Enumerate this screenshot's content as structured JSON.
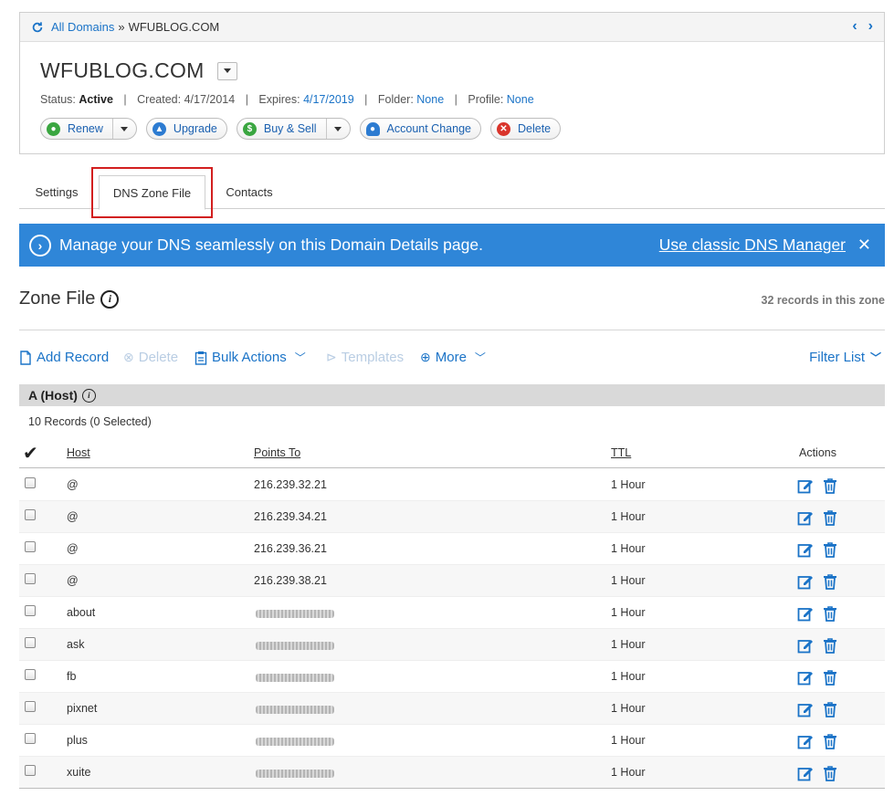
{
  "breadcrumb": {
    "root": "All Domains",
    "separator": "»",
    "current": "WFUBLOG.COM"
  },
  "domain": {
    "name": "WFUBLOG.COM",
    "status_label": "Status:",
    "status_value": "Active",
    "created_label": "Created:",
    "created_value": "4/17/2014",
    "expires_label": "Expires:",
    "expires_value": "4/17/2019",
    "folder_label": "Folder:",
    "folder_value": "None",
    "profile_label": "Profile:",
    "profile_value": "None"
  },
  "actions": {
    "renew": "Renew",
    "upgrade": "Upgrade",
    "buy_sell": "Buy & Sell",
    "account_change": "Account Change",
    "delete": "Delete"
  },
  "tabs": {
    "settings": "Settings",
    "dns_zone_file": "DNS Zone File",
    "contacts": "Contacts"
  },
  "banner": {
    "text": "Manage your DNS seamlessly on this Domain Details page.",
    "link": "Use classic DNS Manager",
    "close": "✕"
  },
  "zone": {
    "title": "Zone File",
    "count": "32 records in this zone"
  },
  "toolbar": {
    "add_record": "Add Record",
    "delete": "Delete",
    "bulk_actions": "Bulk Actions",
    "templates": "Templates",
    "more": "More",
    "filter_list": "Filter List"
  },
  "section": {
    "title": "A (Host)",
    "records": "10 Records (0 Selected)"
  },
  "table": {
    "headers": {
      "host": "Host",
      "points_to": "Points To",
      "ttl": "TTL",
      "actions": "Actions"
    },
    "rows": [
      {
        "host": "@",
        "points_to": "216.239.32.21",
        "ttl": "1 Hour"
      },
      {
        "host": "@",
        "points_to": "216.239.34.21",
        "ttl": "1 Hour"
      },
      {
        "host": "@",
        "points_to": "216.239.36.21",
        "ttl": "1 Hour"
      },
      {
        "host": "@",
        "points_to": "216.239.38.21",
        "ttl": "1 Hour"
      },
      {
        "host": "about",
        "points_to": "",
        "ttl": "1 Hour"
      },
      {
        "host": "ask",
        "points_to": "",
        "ttl": "1 Hour"
      },
      {
        "host": "fb",
        "points_to": "",
        "ttl": "1 Hour"
      },
      {
        "host": "pixnet",
        "points_to": "",
        "ttl": "1 Hour"
      },
      {
        "host": "plus",
        "points_to": "",
        "ttl": "1 Hour"
      },
      {
        "host": "xuite",
        "points_to": "",
        "ttl": "1 Hour"
      }
    ]
  },
  "colors": {
    "accent": "#1a73c7",
    "banner": "#2f86d8",
    "highlight": "#d21f1f"
  }
}
